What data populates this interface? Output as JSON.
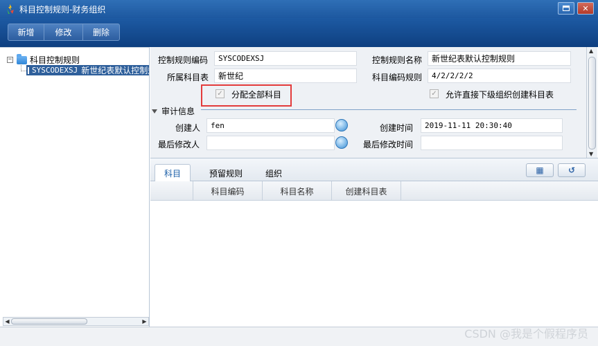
{
  "window": {
    "title": "科目控制规则-财务组织",
    "app_icon": "colorful-flame-icon",
    "maximize_icon": "maximize-icon",
    "close_icon": "close-icon"
  },
  "toolbar": {
    "buttons": [
      "新增",
      "修改",
      "删除"
    ]
  },
  "tree": {
    "root_label": "科目控制规则",
    "child_code": "SYSCODEXSJ",
    "child_name": "新世纪表默认控制规则"
  },
  "form": {
    "rule_code_label": "控制规则编码",
    "rule_code_value": "SYSCODEXSJ",
    "rule_name_label": "控制规则名称",
    "rule_name_value": "新世纪表默认控制规则",
    "subject_table_label": "所属科目表",
    "subject_table_value": "新世纪",
    "code_rule_label": "科目编码规则",
    "code_rule_value": "4/2/2/2/2",
    "assign_all_label": "分配全部科目",
    "allow_sub_label": "允许直接下级组织创建科目表",
    "audit_section_label": "审计信息",
    "creator_label": "创建人",
    "creator_value": "fen",
    "create_time_label": "创建时间",
    "create_time_value": "2019-11-11 20:30:40",
    "modifier_label": "最后修改人",
    "modifier_value": "",
    "modify_time_label": "最后修改时间",
    "modify_time_value": ""
  },
  "tabs": [
    "科目",
    "预留规则",
    "组织"
  ],
  "grid": {
    "columns": [
      "科目编码",
      "科目名称",
      "创建科目表"
    ]
  },
  "watermark": "CSDN @我是个假程序员",
  "colors": {
    "titlebar": "#1d58a0",
    "highlight_box": "#e33b3b",
    "selection": "#2e5f9b"
  }
}
